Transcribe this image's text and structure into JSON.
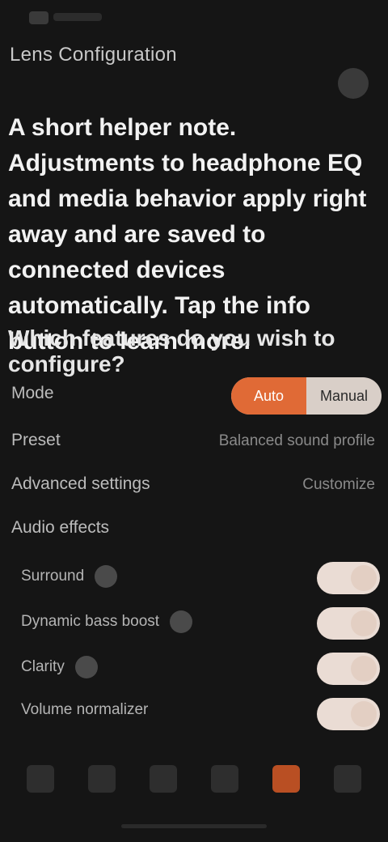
{
  "header": {
    "breadcrumb": "Lens Configuration"
  },
  "description": "A short helper note. Adjustments to headphone EQ and media behavior apply right away and are saved to connected devices automatically. Tap the info button to learn more.",
  "section": {
    "title": "Which features do you wish to configure?"
  },
  "rows": {
    "mode": {
      "label": "Mode",
      "options": [
        "Auto",
        "Manual"
      ],
      "selected": "Auto"
    },
    "preset": {
      "label": "Preset",
      "value": "Balanced sound profile"
    },
    "advanced": {
      "label": "Advanced settings",
      "value": "Customize"
    },
    "effects": {
      "label": "Audio effects"
    }
  },
  "toggles": [
    {
      "label": "Surround",
      "help": true,
      "on": true
    },
    {
      "label": "Dynamic bass boost",
      "help": true,
      "on": true
    },
    {
      "label": "Clarity",
      "help": true,
      "on": true
    },
    {
      "label": "Volume normalizer",
      "help": false,
      "on": true
    }
  ],
  "nav": {
    "items": [
      "home-icon",
      "play-icon",
      "library-icon",
      "devices-icon",
      "settings-icon",
      "profile-icon"
    ],
    "active_index": 4
  },
  "colors": {
    "accent": "#e06a36",
    "background": "#151515"
  }
}
